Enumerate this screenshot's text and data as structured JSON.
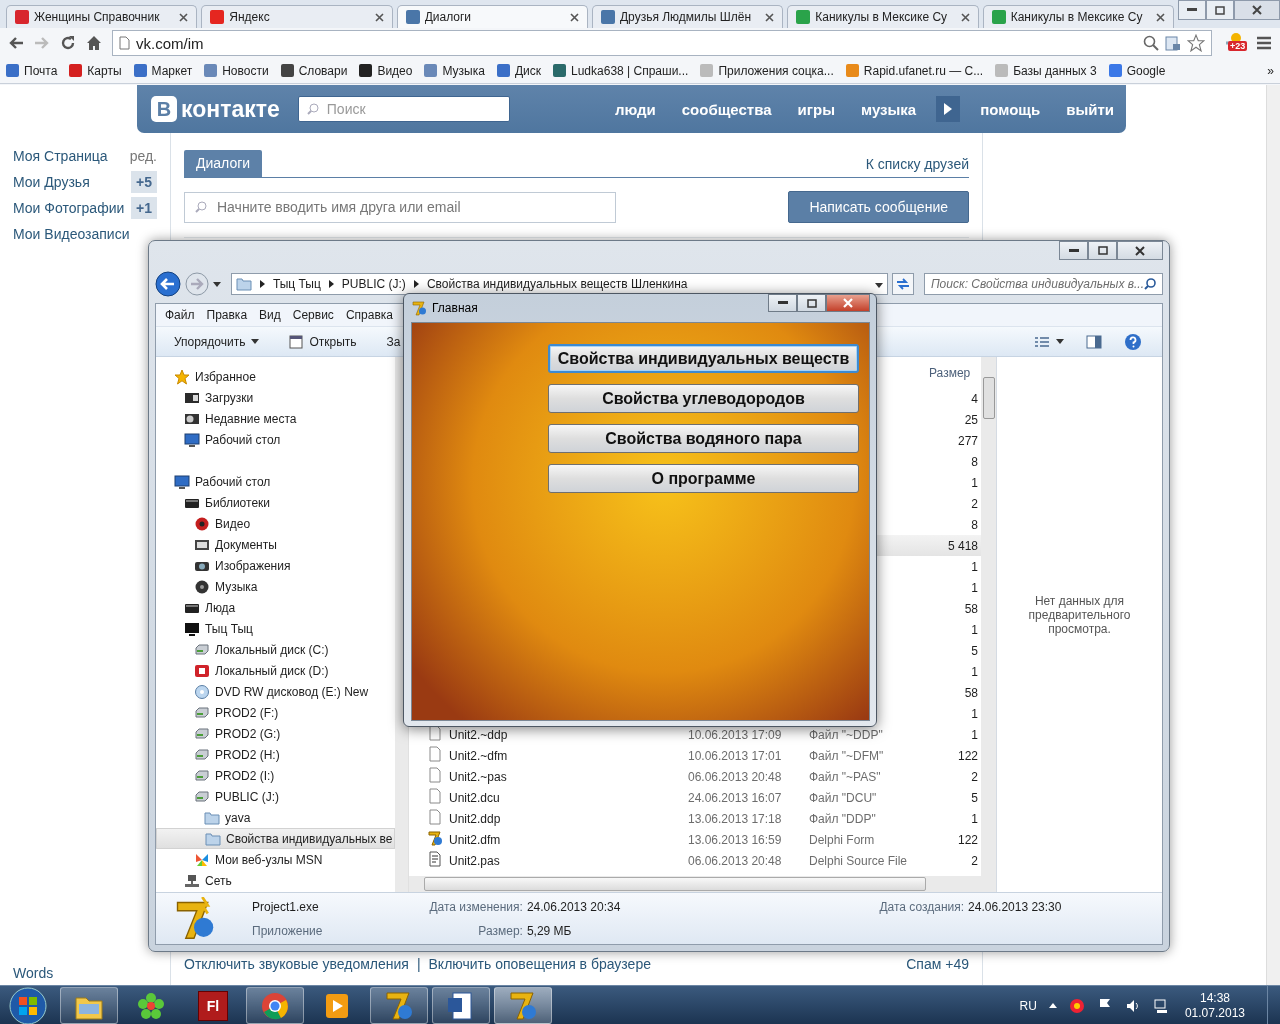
{
  "browser": {
    "tabs": [
      {
        "title": "Женщины Справочник",
        "color": "#d8262d",
        "selected": false
      },
      {
        "title": "Яндекс",
        "color": "#e52620",
        "selected": false
      },
      {
        "title": "Диалоги",
        "color": "#4a76a8",
        "selected": true
      },
      {
        "title": "Друзья Людмилы Шлён",
        "color": "#4a76a8",
        "selected": false
      },
      {
        "title": "Каникулы в Мексике Су",
        "color": "#2aa34a",
        "selected": false
      },
      {
        "title": "Каникулы в Мексике Су",
        "color": "#2aa34a",
        "selected": false
      }
    ],
    "address": "vk.com/im",
    "extension_badge": "+23",
    "bookmarks": [
      {
        "label": "Почта",
        "color": "#3b6fc7"
      },
      {
        "label": "Карты",
        "color": "#d42020"
      },
      {
        "label": "Маркет",
        "color": "#3b6fc7"
      },
      {
        "label": "Новости",
        "color": "#6a89b8"
      },
      {
        "label": "Словари",
        "color": "#444444"
      },
      {
        "label": "Видео",
        "color": "#222222"
      },
      {
        "label": "Музыка",
        "color": "#6a89b8"
      },
      {
        "label": "Диск",
        "color": "#3b6fc7"
      },
      {
        "label": "Ludka638 | Спраши...",
        "color": "#2a6a6a"
      },
      {
        "label": "Приложения соцка...",
        "color": "#bbbbbb"
      },
      {
        "label": "Rapid.ufanet.ru — С...",
        "color": "#e88a1a"
      },
      {
        "label": "Базы данных 3",
        "color": "#bbbbbb"
      },
      {
        "label": "Google",
        "color": "#3b78e7"
      }
    ],
    "bookmarks_more": "»"
  },
  "vk": {
    "logo_letter": "В",
    "logo_text": "контакте",
    "search": {
      "placeholder": "Поиск"
    },
    "nav": [
      {
        "kind": "link",
        "label": "люди"
      },
      {
        "kind": "link",
        "label": "сообщества"
      },
      {
        "kind": "link",
        "label": "игры"
      },
      {
        "kind": "link",
        "label": "музыка"
      },
      {
        "kind": "arrow"
      },
      {
        "kind": "link",
        "label": "помощь"
      },
      {
        "kind": "link",
        "label": "выйти"
      }
    ],
    "menu": [
      {
        "label": "Моя Страница",
        "extra": "ред."
      },
      {
        "label": "Мои Друзья",
        "badge": "+5"
      },
      {
        "label": "Мои Фотографии",
        "badge": "+1"
      },
      {
        "label": "Мои Видеозаписи"
      }
    ],
    "menu_bottom": "Words",
    "dialogs": {
      "tab": "Диалоги",
      "friends_link": "К списку друзей",
      "search": {
        "placeholder": "Начните вводить имя друга или email"
      },
      "compose_button": "Написать сообщение",
      "footer_links": [
        "Отключить звуковые уведомления",
        "Включить оповещения в браузере"
      ],
      "footer_separator": "|",
      "spam": "Спам +49"
    }
  },
  "explorer": {
    "breadcrumbs": [
      "Тыц Тыц",
      "PUBLIC (J:)",
      "Свойства индивидуальных веществ Шленкина"
    ],
    "search": {
      "placeholder": "Поиск: Свойства индивидуальных в..."
    },
    "menu": [
      "Файл",
      "Правка",
      "Вид",
      "Сервис",
      "Справка"
    ],
    "toolbar": [
      {
        "kind": "dropdown",
        "label": "Упорядочить"
      },
      {
        "kind": "open",
        "label": "Открыть"
      },
      {
        "kind": "plain",
        "label": "За"
      }
    ],
    "tree": [
      {
        "label": "Избранное",
        "kind": "star",
        "selected": false,
        "children": [
          {
            "label": "Загрузки",
            "kind": "folder-dark",
            "selected": false
          },
          {
            "label": "Недавние места",
            "kind": "recent",
            "selected": false
          },
          {
            "label": "Рабочий стол",
            "kind": "desktop",
            "selected": false
          }
        ]
      },
      {
        "label": "Рабочий стол",
        "kind": "desktop",
        "selected": false,
        "children": [
          {
            "label": "Библиотеки",
            "kind": "library",
            "selected": false,
            "children": [
              {
                "label": "Видео",
                "kind": "video",
                "selected": false
              },
              {
                "label": "Документы",
                "kind": "docs",
                "selected": false
              },
              {
                "label": "Изображения",
                "kind": "images",
                "selected": false
              },
              {
                "label": "Музыка",
                "kind": "music",
                "selected": false
              }
            ]
          },
          {
            "label": "Люда",
            "kind": "library",
            "selected": false
          },
          {
            "label": "Тыц Тыц",
            "kind": "computer",
            "selected": false,
            "children": [
              {
                "label": "Локальный диск (C:)",
                "kind": "drive",
                "selected": false
              },
              {
                "label": "Локальный диск (D:)",
                "kind": "drive-red",
                "selected": false
              },
              {
                "label": "DVD RW дисковод (E:) New",
                "kind": "dvd",
                "selected": false
              },
              {
                "label": "PROD2 (F:)",
                "kind": "drive",
                "selected": false
              },
              {
                "label": "PROD2 (G:)",
                "kind": "drive",
                "selected": false
              },
              {
                "label": "PROD2 (H:)",
                "kind": "drive",
                "selected": false
              },
              {
                "label": "PROD2 (I:)",
                "kind": "drive",
                "selected": false
              },
              {
                "label": "PUBLIC (J:)",
                "kind": "drive",
                "selected": false,
                "children": [
                  {
                    "label": "yava",
                    "kind": "folder",
                    "selected": false
                  },
                  {
                    "label": "Свойства индивидуальных ве",
                    "kind": "folder",
                    "selected": true
                  }
                ]
              },
              {
                "label": "Мои веб-узлы MSN",
                "kind": "msn",
                "selected": false
              }
            ]
          },
          {
            "label": "Сеть",
            "kind": "network",
            "selected": false
          }
        ]
      }
    ],
    "size_column": "Размер",
    "rows": [
      {
        "size": "4",
        "selected": false
      },
      {
        "size": "25",
        "selected": false
      },
      {
        "size": "277",
        "selected": false
      },
      {
        "size": "8",
        "selected": false
      },
      {
        "size": "1",
        "selected": false
      },
      {
        "size": "2",
        "selected": false
      },
      {
        "size": "8",
        "selected": false
      },
      {
        "size": "5 418",
        "selected": true
      },
      {
        "size": "1",
        "selected": false
      },
      {
        "size": "1",
        "selected": false
      },
      {
        "size": "58",
        "selected": false
      },
      {
        "size": "1",
        "selected": false
      },
      {
        "size": "5",
        "selected": false
      },
      {
        "size": "1",
        "selected": false
      },
      {
        "size": "58",
        "selected": false
      },
      {
        "size": "1",
        "selected": false
      },
      {
        "kind": "file",
        "name": "Unit2.~ddp",
        "date": "10.06.2013 17:09",
        "type": "Файл \"~DDP\"",
        "size": "1",
        "selected": false
      },
      {
        "kind": "file",
        "name": "Unit2.~dfm",
        "date": "10.06.2013 17:01",
        "type": "Файл \"~DFM\"",
        "size": "122",
        "selected": false
      },
      {
        "kind": "file",
        "name": "Unit2.~pas",
        "date": "06.06.2013 20:48",
        "type": "Файл \"~PAS\"",
        "size": "2",
        "selected": false
      },
      {
        "kind": "file",
        "name": "Unit2.dcu",
        "date": "24.06.2013 16:07",
        "type": "Файл \"DCU\"",
        "size": "5",
        "selected": false
      },
      {
        "kind": "file",
        "name": "Unit2.ddp",
        "date": "13.06.2013 17:18",
        "type": "Файл \"DDP\"",
        "size": "1",
        "selected": false
      },
      {
        "kind": "delphi-form",
        "name": "Unit2.dfm",
        "date": "13.06.2013 16:59",
        "type": "Delphi Form",
        "size": "122",
        "selected": false
      },
      {
        "kind": "delphi-source",
        "name": "Unit2.pas",
        "date": "06.06.2013 20:48",
        "type": "Delphi Source File",
        "size": "2",
        "selected": false
      }
    ],
    "preview": "Нет данных для предварительного просмотра.",
    "details": {
      "name": "Project1.exe",
      "type": "Приложение",
      "fields": [
        {
          "label": "Дата изменения:",
          "value": "24.06.2013 20:34"
        },
        {
          "label": "Размер:",
          "value": "5,29 МБ"
        },
        {
          "label": "Дата создания:",
          "value": "24.06.2013 23:30"
        }
      ]
    }
  },
  "app": {
    "title": "Главная",
    "buttons": [
      {
        "label": "Свойства индивидуальных веществ",
        "selected": true
      },
      {
        "label": "Свойства углеводородов",
        "selected": false
      },
      {
        "label": "Свойства водяного пара",
        "selected": false
      },
      {
        "label": "О программе",
        "selected": false
      }
    ]
  },
  "taskbar": {
    "items": [
      {
        "kind": "explorer",
        "running": true,
        "active": false
      },
      {
        "kind": "icq",
        "running": false,
        "active": false
      },
      {
        "kind": "flash",
        "label": "Fl",
        "running": false,
        "active": false
      },
      {
        "kind": "chrome",
        "running": true,
        "active": false
      },
      {
        "kind": "media",
        "running": false,
        "active": false
      },
      {
        "kind": "delphi",
        "running": true,
        "active": false
      },
      {
        "kind": "word",
        "running": true,
        "active": false
      },
      {
        "kind": "delphi",
        "running": true,
        "active": true
      }
    ],
    "language": "RU",
    "time": "14:38",
    "date": "01.07.2013"
  }
}
